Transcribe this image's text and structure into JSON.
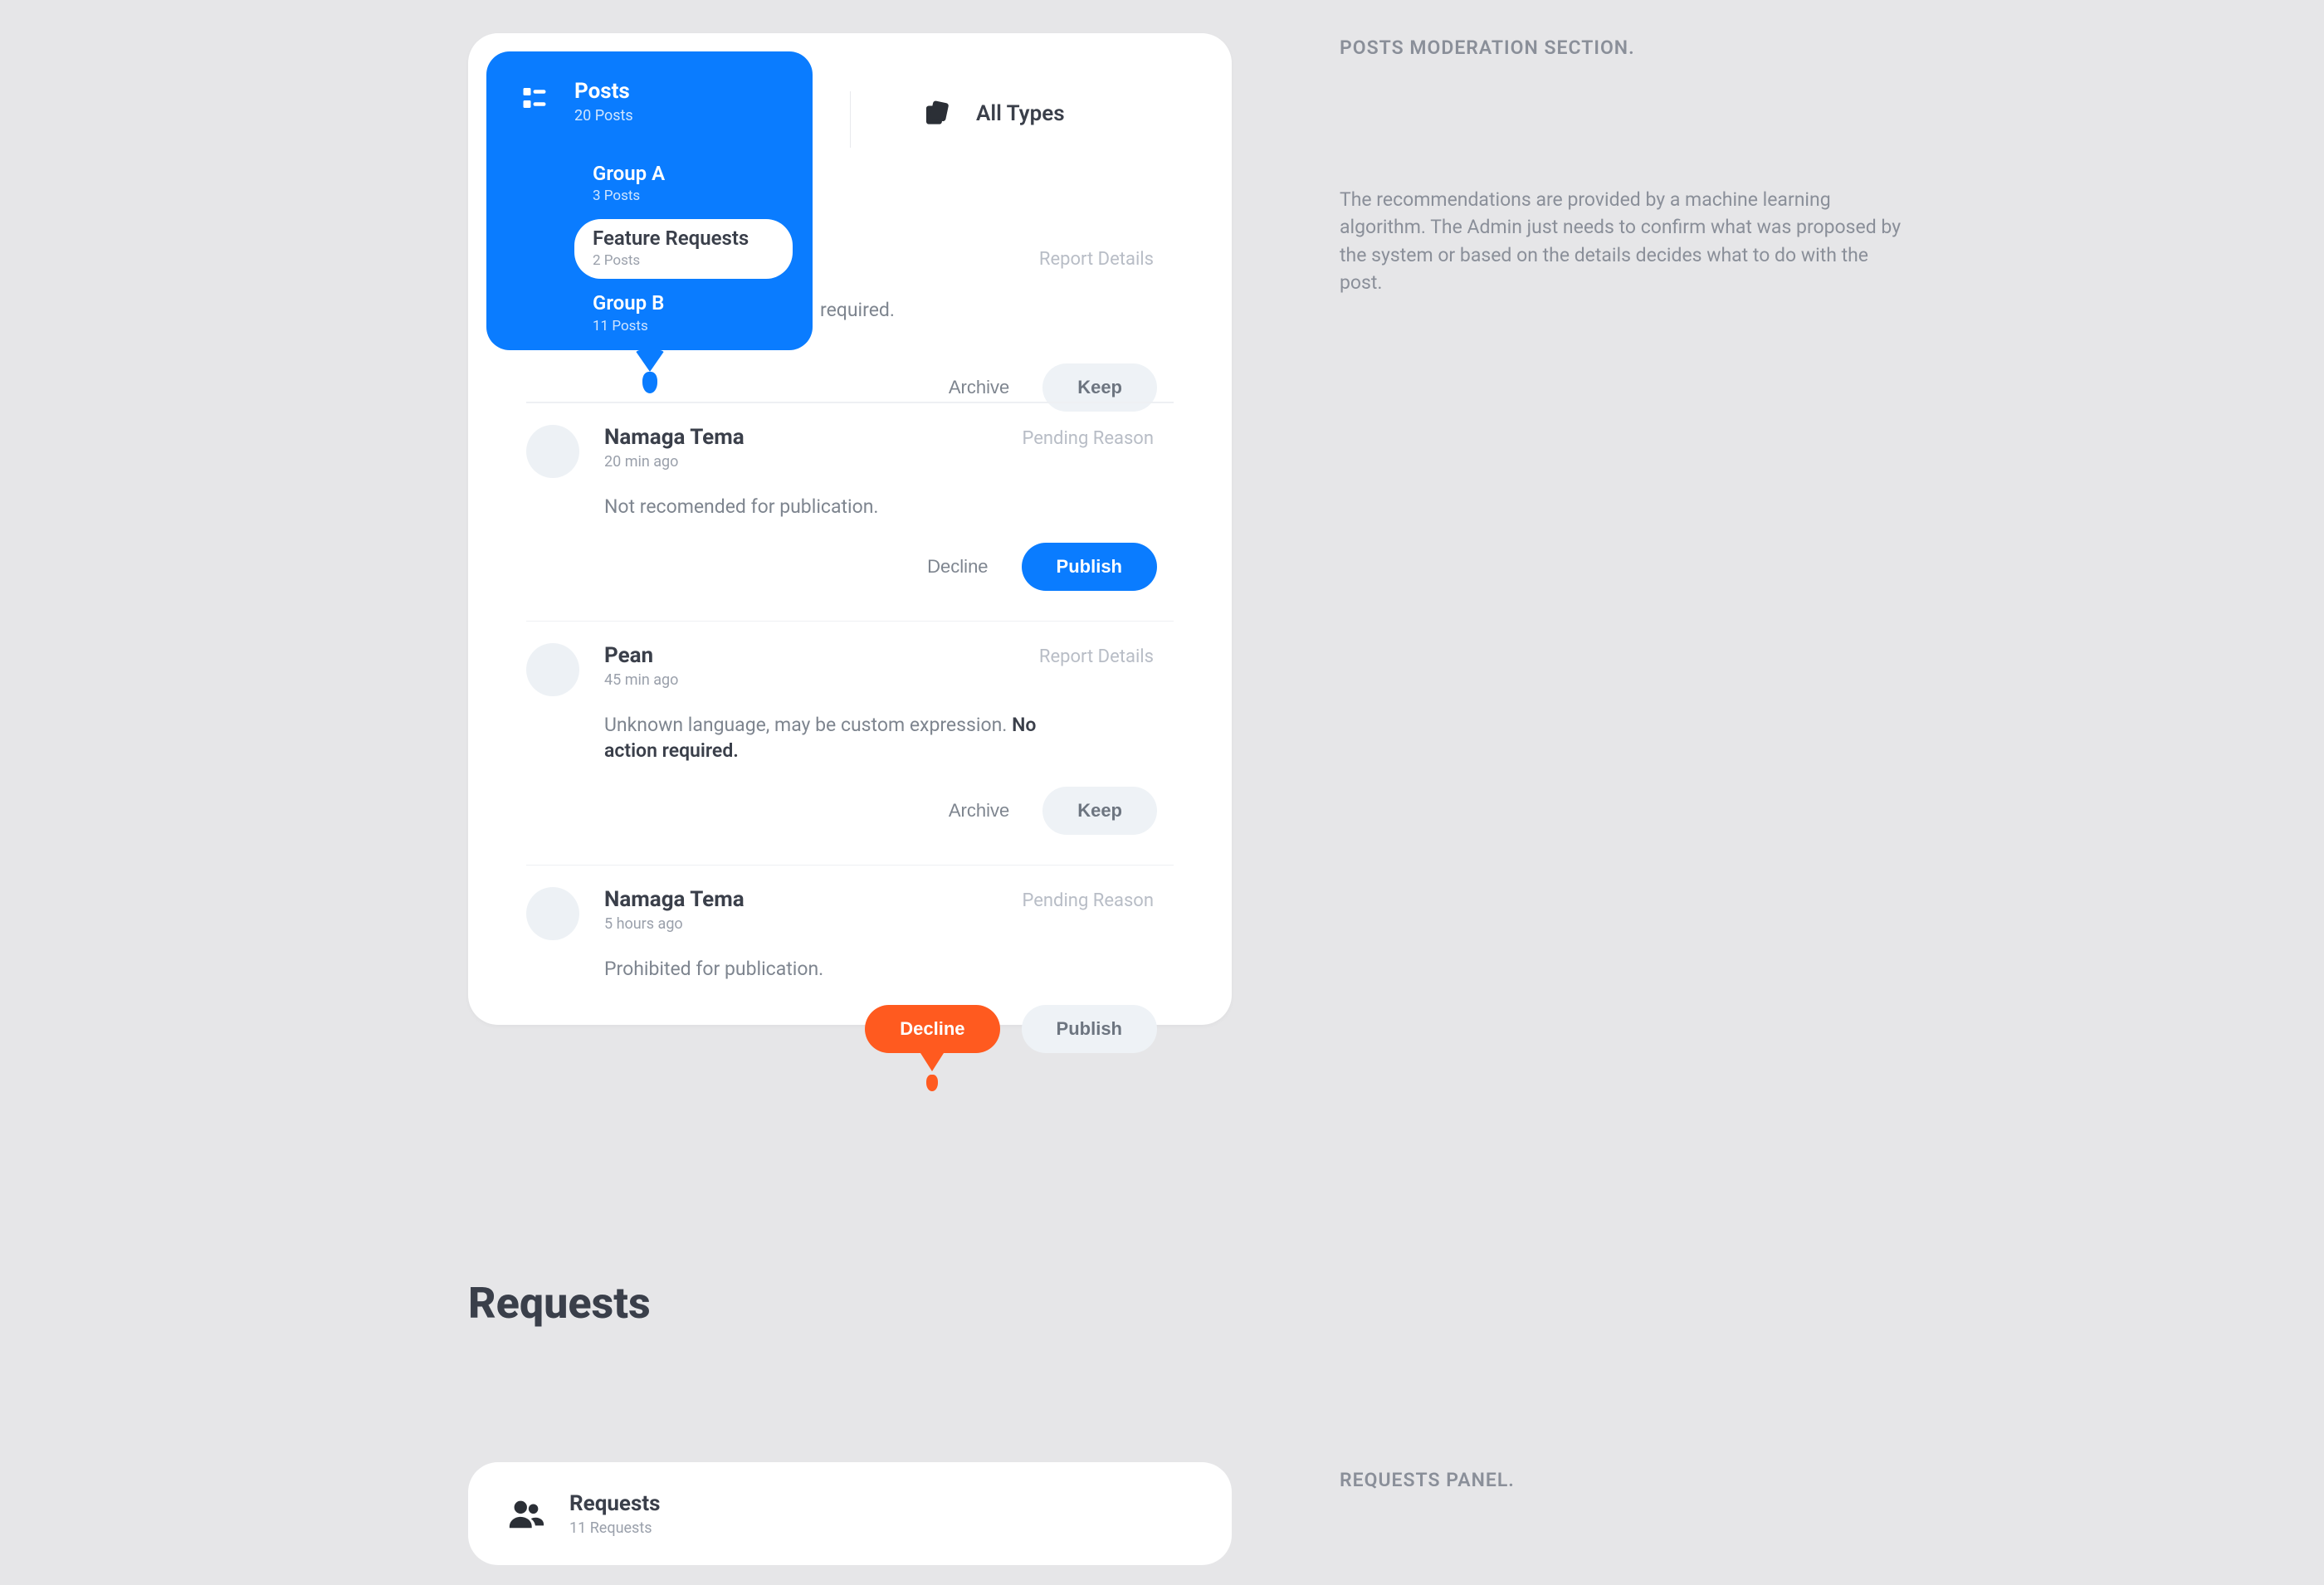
{
  "section_labels": {
    "posts_moderation": "POSTS MODERATION SECTION.",
    "requests_panel": "REQUESTS PANEL."
  },
  "section_paragraph": "The recommendations are provided by a machine learning algorithm. The Admin just needs to confirm what was proposed by the system or based on the details decides what to do with the post.",
  "dropdown": {
    "header": {
      "title": "Posts",
      "subtitle": "20 Posts"
    },
    "items": [
      {
        "title": "Group A",
        "subtitle": "3 Posts",
        "selected": false
      },
      {
        "title": "Feature Requests",
        "subtitle": "2 Posts",
        "selected": true
      },
      {
        "title": "Group B",
        "subtitle": "11 Posts",
        "selected": false
      }
    ]
  },
  "all_types_label": "All Types",
  "peek_text": "required.",
  "posts": [
    {
      "name": "Namaga Tema",
      "time": "20 min ago",
      "link": "Pending Reason",
      "desc_plain": "Not recomended for publication.",
      "actions": {
        "secondary": "Decline",
        "primary": "Publish",
        "primary_style": "blue"
      }
    },
    {
      "name": "Pean",
      "time": "45 min ago",
      "link": "Report Details",
      "desc_prefix": "Unknown language, may be custom expression. ",
      "desc_emph": "No action required.",
      "actions": {
        "secondary": "Archive",
        "primary": "Keep",
        "primary_style": "grey"
      }
    },
    {
      "name": "Namaga Tema",
      "time": "5 hours ago",
      "link": "Pending Reason",
      "desc_plain": "Prohibited for publication.",
      "actions": {
        "secondary": "Decline",
        "primary": "Publish",
        "primary_style": "grey",
        "secondary_style": "orange"
      }
    }
  ],
  "first_row_actions": {
    "secondary": "Archive",
    "primary": "Keep"
  },
  "first_row_link": "Report Details",
  "requests_heading": "Requests",
  "requests_panel": {
    "title": "Requests",
    "subtitle": "11 Requests"
  }
}
